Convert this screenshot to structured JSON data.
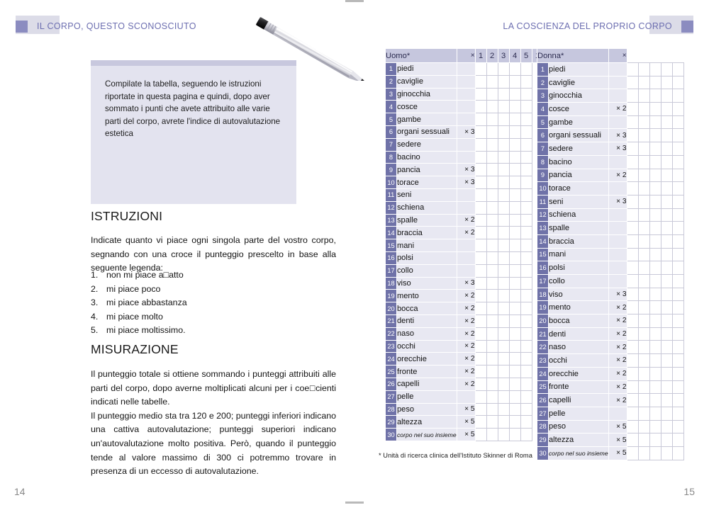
{
  "header": {
    "left_title": "IL CORPO, QUESTO SCONOSCIUTO",
    "right_title": "LA COSCIENZA DEL PROPRIO CORPO"
  },
  "callout": {
    "text": "Compilate la tabella, seguendo le istruzioni riportate in questa pagina e quindi, dopo aver sommato i punti che avete attribuito alle varie parti del corpo, avrete l'indice di autovalutazione estetica"
  },
  "istruzioni": {
    "title": "ISTRUZIONI",
    "intro": "Indicate quanto vi piace ogni singola parte del vostro corpo, segnando con una croce il punteggio prescelto in base alla seguente legenda:",
    "legend": [
      {
        "num": "1.",
        "label": "non mi piace a□atto"
      },
      {
        "num": "2.",
        "label": "mi piace poco"
      },
      {
        "num": "3.",
        "label": "mi piace abbastanza"
      },
      {
        "num": "4.",
        "label": "mi piace molto"
      },
      {
        "num": "5.",
        "label": "mi piace moltissimo."
      }
    ]
  },
  "misurazione": {
    "title": "MISURAZIONE",
    "body": "Il punteggio totale si ottiene sommando i punteggi attribuiti alle parti del corpo, dopo averne moltiplicati alcuni per i coe□cienti indicati nelle tabelle.\nIl punteggio medio sta tra 120 e 200; punteggi inferiori indicano una cattiva autovalutazione; punteggi superiori indicano un'autovalutazione molto positiva. Però, quando il punteggio tende al valore massimo di 300 ci potremmo trovare in presenza di un eccesso di autovalutazione."
  },
  "tables": {
    "score_columns": [
      "1",
      "2",
      "3",
      "4",
      "5"
    ],
    "multiplier_header": "×",
    "uomo": {
      "title": "Uomo*",
      "rows": [
        {
          "n": "1",
          "name": "piedi",
          "mult": ""
        },
        {
          "n": "2",
          "name": "caviglie",
          "mult": ""
        },
        {
          "n": "3",
          "name": "ginocchia",
          "mult": ""
        },
        {
          "n": "4",
          "name": "cosce",
          "mult": ""
        },
        {
          "n": "5",
          "name": "gambe",
          "mult": ""
        },
        {
          "n": "6",
          "name": "organi sessuali",
          "mult": "× 3"
        },
        {
          "n": "7",
          "name": "sedere",
          "mult": ""
        },
        {
          "n": "8",
          "name": "bacino",
          "mult": ""
        },
        {
          "n": "9",
          "name": "pancia",
          "mult": "× 3"
        },
        {
          "n": "10",
          "name": "torace",
          "mult": "× 3"
        },
        {
          "n": "11",
          "name": "seni",
          "mult": ""
        },
        {
          "n": "12",
          "name": "schiena",
          "mult": ""
        },
        {
          "n": "13",
          "name": "spalle",
          "mult": "× 2"
        },
        {
          "n": "14",
          "name": "braccia",
          "mult": "× 2"
        },
        {
          "n": "15",
          "name": "mani",
          "mult": ""
        },
        {
          "n": "16",
          "name": "polsi",
          "mult": ""
        },
        {
          "n": "17",
          "name": "collo",
          "mult": ""
        },
        {
          "n": "18",
          "name": "viso",
          "mult": "× 3"
        },
        {
          "n": "19",
          "name": "mento",
          "mult": "× 2"
        },
        {
          "n": "20",
          "name": "bocca",
          "mult": "× 2"
        },
        {
          "n": "21",
          "name": "denti",
          "mult": "× 2"
        },
        {
          "n": "22",
          "name": "naso",
          "mult": "× 2"
        },
        {
          "n": "23",
          "name": "occhi",
          "mult": "× 2"
        },
        {
          "n": "24",
          "name": "orecchie",
          "mult": "× 2"
        },
        {
          "n": "25",
          "name": "fronte",
          "mult": "× 2"
        },
        {
          "n": "26",
          "name": "capelli",
          "mult": "× 2"
        },
        {
          "n": "27",
          "name": "pelle",
          "mult": ""
        },
        {
          "n": "28",
          "name": "peso",
          "mult": "× 5"
        },
        {
          "n": "29",
          "name": "altezza",
          "mult": "× 5"
        },
        {
          "n": "30",
          "name": "corpo nel suo insieme",
          "mult": "× 5",
          "italic": true
        }
      ]
    },
    "donna": {
      "title": "Donna*",
      "rows": [
        {
          "n": "1",
          "name": "piedi",
          "mult": ""
        },
        {
          "n": "2",
          "name": "caviglie",
          "mult": ""
        },
        {
          "n": "3",
          "name": "ginocchia",
          "mult": ""
        },
        {
          "n": "4",
          "name": "cosce",
          "mult": "× 2"
        },
        {
          "n": "5",
          "name": "gambe",
          "mult": ""
        },
        {
          "n": "6",
          "name": "organi sessuali",
          "mult": "× 3"
        },
        {
          "n": "7",
          "name": "sedere",
          "mult": "× 3"
        },
        {
          "n": "8",
          "name": "bacino",
          "mult": ""
        },
        {
          "n": "9",
          "name": "pancia",
          "mult": "× 2"
        },
        {
          "n": "10",
          "name": "torace",
          "mult": ""
        },
        {
          "n": "11",
          "name": "seni",
          "mult": "× 3"
        },
        {
          "n": "12",
          "name": "schiena",
          "mult": ""
        },
        {
          "n": "13",
          "name": "spalle",
          "mult": ""
        },
        {
          "n": "14",
          "name": "braccia",
          "mult": ""
        },
        {
          "n": "15",
          "name": "mani",
          "mult": ""
        },
        {
          "n": "16",
          "name": "polsi",
          "mult": ""
        },
        {
          "n": "17",
          "name": "collo",
          "mult": ""
        },
        {
          "n": "18",
          "name": "viso",
          "mult": "× 3"
        },
        {
          "n": "19",
          "name": "mento",
          "mult": "× 2"
        },
        {
          "n": "20",
          "name": "bocca",
          "mult": "× 2"
        },
        {
          "n": "21",
          "name": "denti",
          "mult": "× 2"
        },
        {
          "n": "22",
          "name": "naso",
          "mult": "× 2"
        },
        {
          "n": "23",
          "name": "occhi",
          "mult": "× 2"
        },
        {
          "n": "24",
          "name": "orecchie",
          "mult": "× 2"
        },
        {
          "n": "25",
          "name": "fronte",
          "mult": "× 2"
        },
        {
          "n": "26",
          "name": "capelli",
          "mult": "× 2"
        },
        {
          "n": "27",
          "name": "pelle",
          "mult": ""
        },
        {
          "n": "28",
          "name": "peso",
          "mult": "× 5"
        },
        {
          "n": "29",
          "name": "altezza",
          "mult": "× 5"
        },
        {
          "n": "30",
          "name": "corpo nel suo insieme",
          "mult": "× 5",
          "italic": true
        }
      ]
    }
  },
  "footnote": "* Unità di ricerca clinica dell'Istituto Skinner di Roma",
  "folios": {
    "left": "14",
    "right": "15"
  },
  "colors": {
    "accent": "#8b8cc0",
    "header_text": "#6c6eb0",
    "table_header_bg": "#c6c7de",
    "row_num_bg": "#6f72a8",
    "row_bg": "#e8e8f2",
    "callout_bg": "#e3e3ef"
  }
}
